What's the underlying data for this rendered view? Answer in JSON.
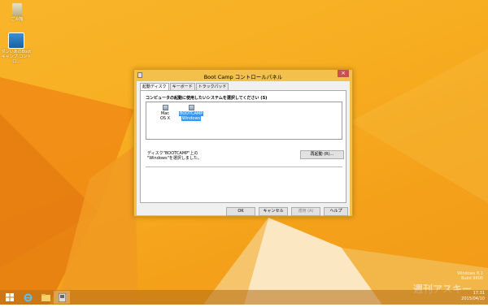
{
  "desktop": {
    "icons": [
      {
        "label": "ごみ箱",
        "icon": "recycle-bin-icon"
      },
      {
        "label": "ダンいあのBootキャンプ コントロ...",
        "icon": "bootcamp-shortcut-icon"
      }
    ]
  },
  "dialog": {
    "title": "Boot Camp コントロールパネル",
    "close_glyph": "×",
    "tabs": [
      "起動ディスク",
      "キーボード",
      "トラックパッド"
    ],
    "prompt": "コンピュータの起動に使用したいシステムを選択してください (S)",
    "disks": [
      {
        "line1": "Mac",
        "line2": "OS X",
        "selected": false
      },
      {
        "line1": "BOOTCAMP",
        "line2": "Windows",
        "selected": true
      }
    ],
    "status_line1": "ディスク\"BOOTCAMP\"上の",
    "status_line2": "\"Windows\"を選択しました。",
    "restart_label": "再起動 (R)...",
    "ok_label": "OK",
    "cancel_label": "キャンセル",
    "apply_label": "適用 (A)",
    "help_label": "ヘルプ"
  },
  "taskbar": {
    "start_icon": "windows-start-icon",
    "items": [
      "internet-explorer-icon",
      "file-explorer-icon",
      "bootcamp-app-icon"
    ],
    "clock_time": "17:31",
    "clock_date": "2015/04/10"
  },
  "watermark": {
    "line1": "Windows 8.1",
    "line2": "Build 9600",
    "logo": "週刊アスキー"
  }
}
